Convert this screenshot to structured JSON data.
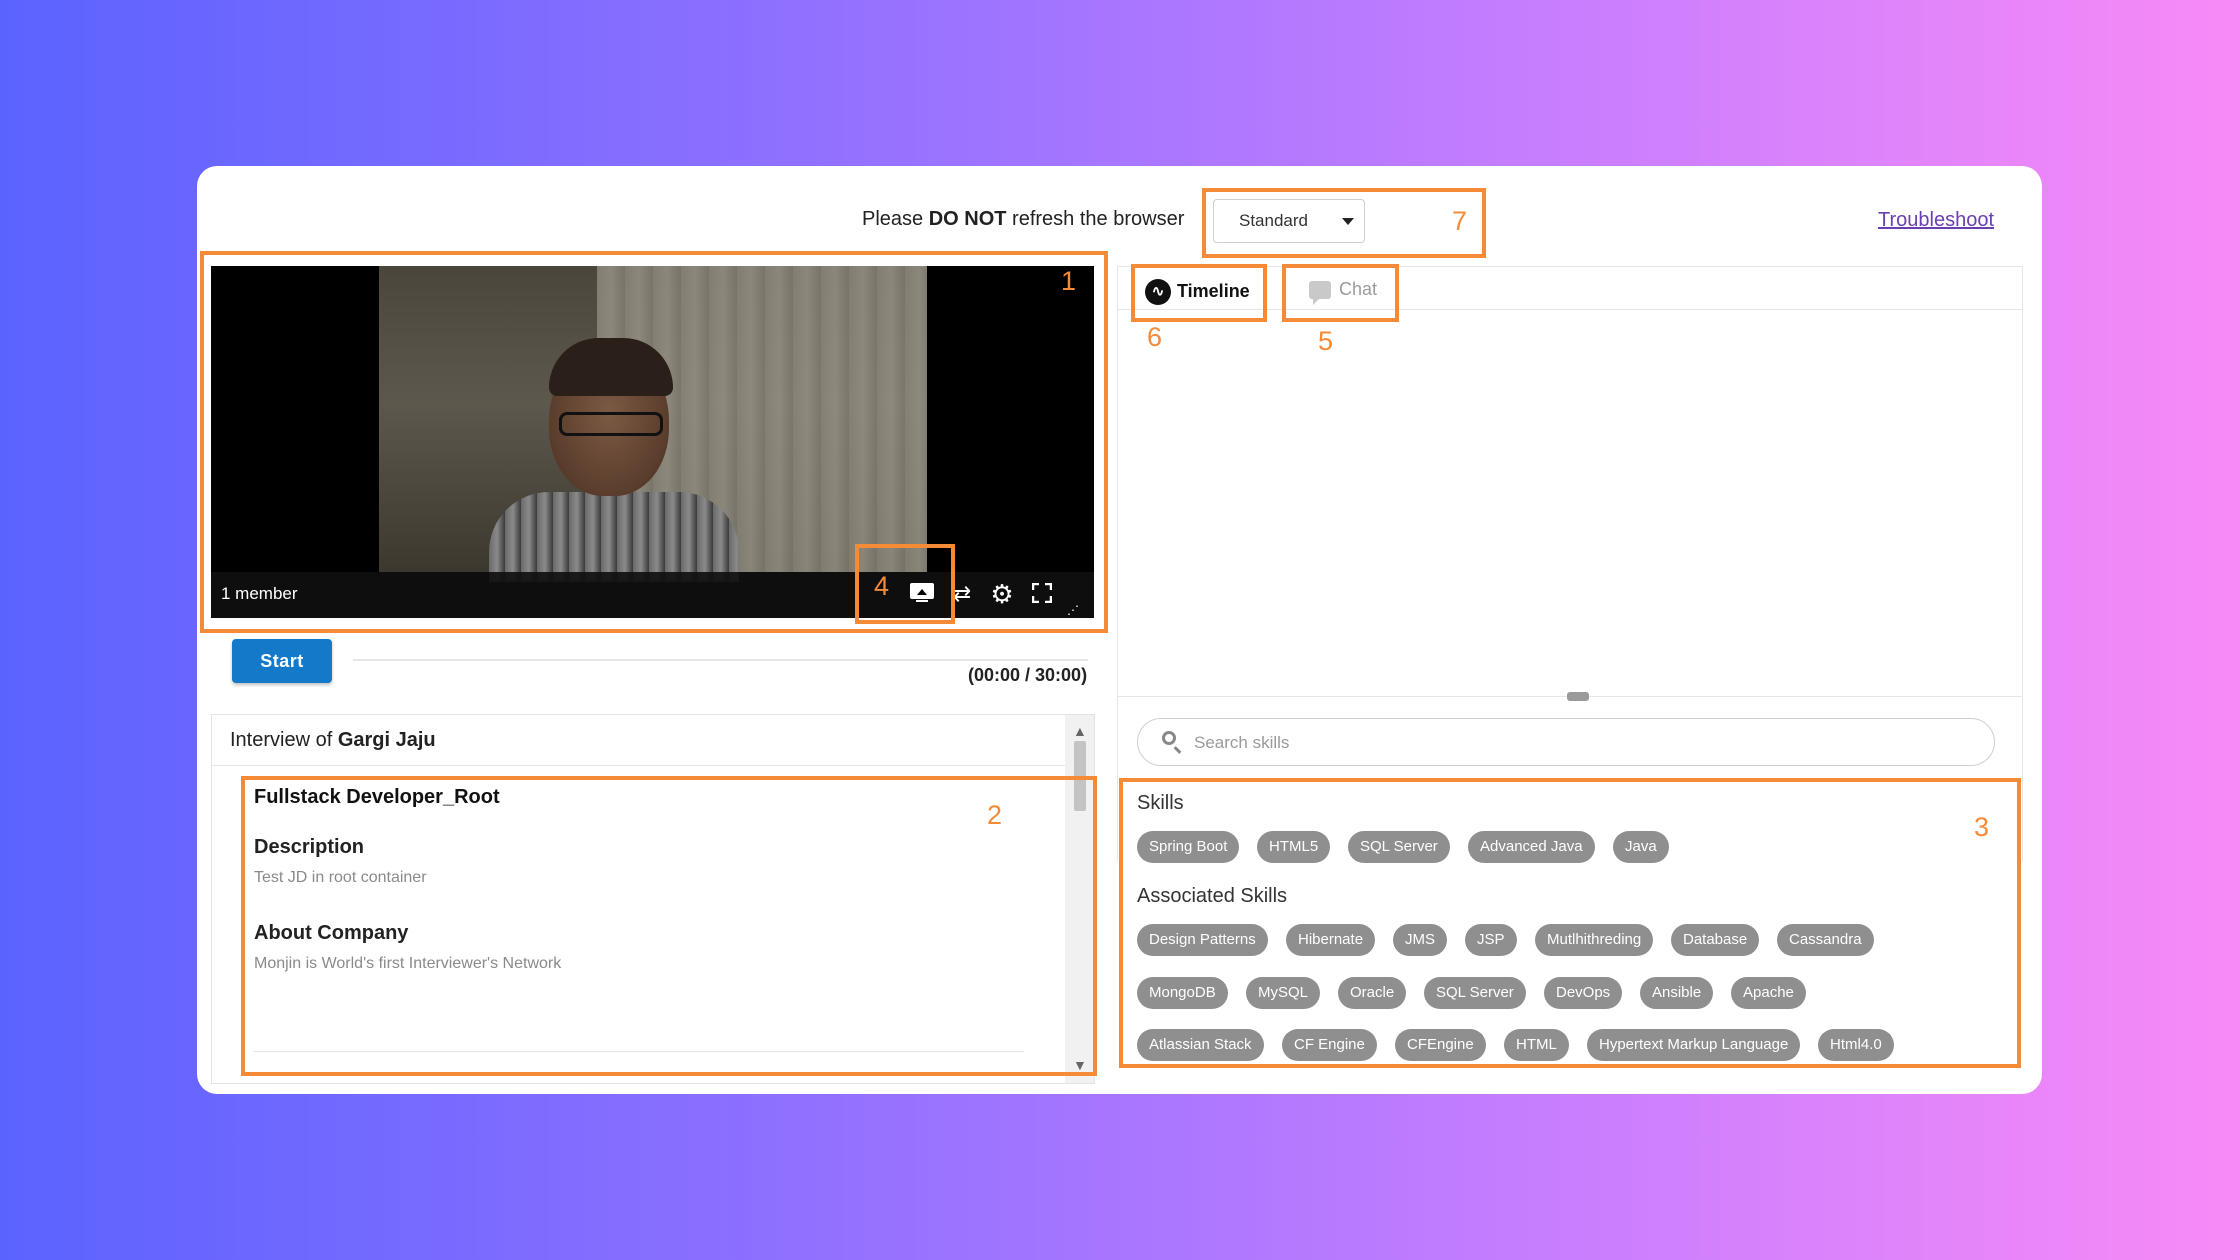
{
  "header": {
    "notice_prefix": "Please ",
    "notice_strong": "DO NOT",
    "notice_suffix": " refresh the browser",
    "quality_select": "Standard",
    "troubleshoot": "Troubleshoot"
  },
  "video": {
    "members": "1 member",
    "controls": [
      "screen-share-icon",
      "swap-icon",
      "gear-icon",
      "fullscreen-icon"
    ]
  },
  "session": {
    "start_label": "Start",
    "timer": "(00:00 / 30:00)"
  },
  "interview": {
    "heading_prefix": "Interview of ",
    "candidate": "Gargi Jaju",
    "job_title": "Fullstack Developer_Root",
    "description_heading": "Description",
    "description_text": "Test JD in root container",
    "about_heading": "About Company",
    "about_text": "Monjin is World's first Interviewer's Network"
  },
  "tabs": {
    "timeline": "Timeline",
    "chat": "Chat"
  },
  "search": {
    "placeholder": "Search skills"
  },
  "skills": {
    "heading": "Skills",
    "items": [
      "Spring Boot",
      "HTML5",
      "SQL Server",
      "Advanced Java",
      "Java"
    ]
  },
  "associated_skills": {
    "heading": "Associated Skills",
    "row1": [
      "Design Patterns",
      "Hibernate",
      "JMS",
      "JSP",
      "Mutlhithreding",
      "Database",
      "Cassandra"
    ],
    "row2": [
      "MongoDB",
      "MySQL",
      "Oracle",
      "SQL Server",
      "DevOps",
      "Ansible",
      "Apache"
    ],
    "row3": [
      "Atlassian Stack",
      "CF Engine",
      "CFEngine",
      "HTML",
      "Hypertext Markup Language",
      "Html4.0"
    ]
  },
  "annotations": [
    "1",
    "2",
    "3",
    "4",
    "5",
    "6",
    "7"
  ],
  "colors": {
    "annotation": "#f58a37",
    "start_button": "#1479c9",
    "chip": "#8f8f8f",
    "troubleshoot_link": "#6a3fb1"
  }
}
